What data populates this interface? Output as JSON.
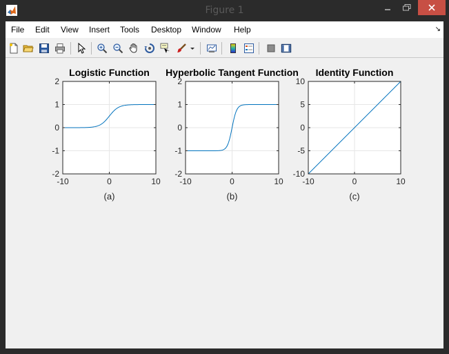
{
  "window": {
    "title": "Figure 1"
  },
  "menu": [
    "File",
    "Edit",
    "View",
    "Insert",
    "Tools",
    "Desktop",
    "Window",
    "Help"
  ],
  "toolbar_icons": [
    "new-figure-icon",
    "open-file-icon",
    "save-icon",
    "print-icon",
    "pointer-icon",
    "zoom-in-icon",
    "zoom-out-icon",
    "pan-hand-icon",
    "rotate-3d-icon",
    "data-cursor-icon",
    "brush-icon",
    "brush-dropdown-icon",
    "link-plot-icon",
    "colorbar-icon",
    "legend-icon",
    "hide-plot-tools-icon",
    "show-plot-tools-icon"
  ],
  "colors": {
    "line": "#0072bd",
    "grid": "#e6e6e6",
    "close": "#c74f44"
  },
  "chart_data": [
    {
      "type": "line",
      "title": "Logistic Function",
      "caption": "(a)",
      "function": "logistic",
      "xlim": [
        -10,
        10
      ],
      "ylim": [
        -2,
        2
      ],
      "xticks": [
        "-10",
        "0",
        "10"
      ],
      "yticks": [
        "-2",
        "-1",
        "0",
        "1",
        "2"
      ],
      "x": [
        -10,
        -6,
        -4,
        -3,
        -2,
        -1,
        0,
        1,
        2,
        3,
        4,
        6,
        10
      ],
      "y": [
        0.0,
        0.002,
        0.018,
        0.047,
        0.119,
        0.269,
        0.5,
        0.731,
        0.881,
        0.953,
        0.982,
        0.998,
        1.0
      ],
      "grid": true
    },
    {
      "type": "line",
      "title": "Hyperbolic Tangent Function",
      "caption": "(b)",
      "function": "tanh",
      "xlim": [
        -10,
        10
      ],
      "ylim": [
        -2,
        2
      ],
      "xticks": [
        "-10",
        "0",
        "10"
      ],
      "yticks": [
        "-2",
        "-1",
        "0",
        "1",
        "2"
      ],
      "x": [
        -10,
        -6,
        -4,
        -3,
        -2,
        -1,
        0,
        1,
        2,
        3,
        4,
        6,
        10
      ],
      "y": [
        -1.0,
        -1.0,
        -0.999,
        -0.995,
        -0.964,
        -0.762,
        0.0,
        0.762,
        0.964,
        0.995,
        0.999,
        1.0,
        1.0
      ],
      "grid": true
    },
    {
      "type": "line",
      "title": "Identity Function",
      "caption": "(c)",
      "function": "identity",
      "xlim": [
        -10,
        10
      ],
      "ylim": [
        -10,
        10
      ],
      "xticks": [
        "-10",
        "0",
        "10"
      ],
      "yticks": [
        "-10",
        "-5",
        "0",
        "5",
        "10"
      ],
      "x": [
        -10,
        10
      ],
      "y": [
        -10,
        10
      ],
      "grid": true
    }
  ]
}
